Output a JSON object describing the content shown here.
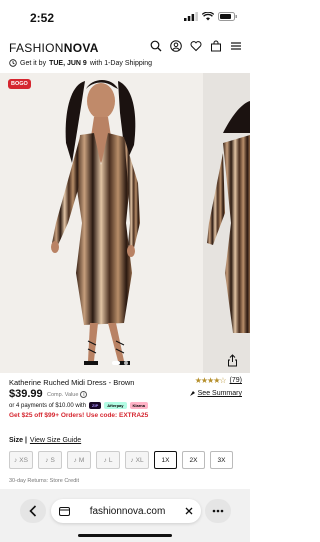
{
  "status": {
    "time": "2:52"
  },
  "nav": {
    "logo_light": "FASHION",
    "logo_bold": "NOVA"
  },
  "shipping": {
    "prefix": "Get it by",
    "date": "TUE, JUN 9",
    "suffix": "with 1-Day Shipping"
  },
  "gallery": {
    "badge": "BOGO"
  },
  "product": {
    "name": "Katherine Ruched Midi Dress - Brown",
    "rating_stars": "★★★★☆",
    "rating_count": "(79)",
    "see_summary": "See Summary",
    "price": "$39.99",
    "comp_value": "Comp. Value",
    "info_glyph": "i",
    "payments_text": "or 4 payments of $10.00 with",
    "pay_zip": "ZIP",
    "pay_afterpay": "Afterpay",
    "pay_klarna": "Klarna",
    "promo": "Get $25 off $99+ Orders! Use code: EXTRA25"
  },
  "size": {
    "label": "Size |",
    "guide": "View Size Guide",
    "options": [
      {
        "label": "XS",
        "available": false
      },
      {
        "label": "S",
        "available": false
      },
      {
        "label": "M",
        "available": false
      },
      {
        "label": "L",
        "available": false
      },
      {
        "label": "XL",
        "available": false
      },
      {
        "label": "1X",
        "available": true
      },
      {
        "label": "2X",
        "available": true
      },
      {
        "label": "3X",
        "available": true
      }
    ]
  },
  "returns": "30-day Returns: Store Credit",
  "browser": {
    "url": "fashionnova.com"
  },
  "colors": {
    "accent": "#d5262f",
    "star": "#b58f2b"
  }
}
